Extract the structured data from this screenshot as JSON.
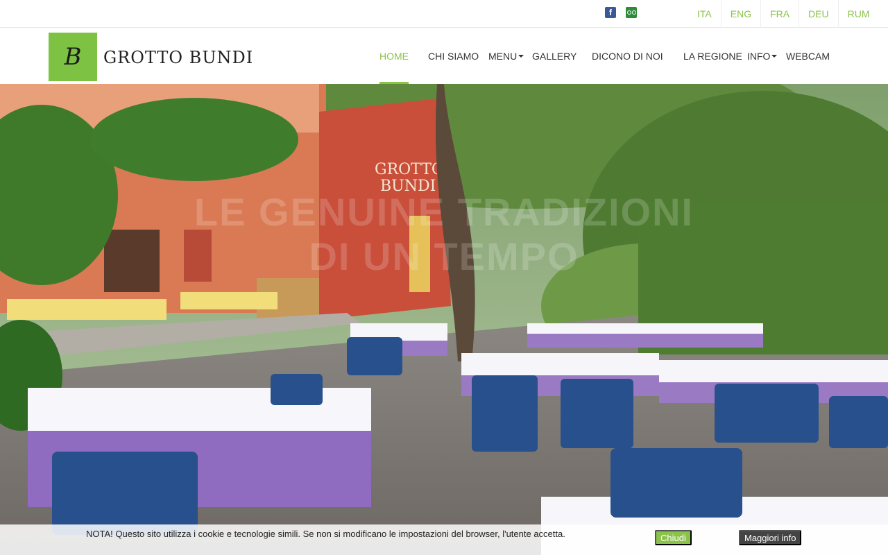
{
  "topbar": {
    "social": [
      {
        "name": "facebook-icon",
        "glyph": "f"
      },
      {
        "name": "tripadvisor-icon"
      }
    ],
    "languages": [
      "ITA",
      "ENG",
      "FRA",
      "DEU",
      "RUM"
    ]
  },
  "header": {
    "logo_mark": "B",
    "logo_text": "GROTTO BUNDI",
    "nav": [
      {
        "label": "HOME",
        "active": true
      },
      {
        "label": "CHI SIAMO"
      },
      {
        "label": "MENU",
        "dropdown": true
      },
      {
        "label": "GALLERY"
      },
      {
        "label": "DICONO DI NOI"
      },
      {
        "label": "LA REGIONE"
      },
      {
        "label": "INFO",
        "dropdown": true
      },
      {
        "label": "WEBCAM"
      }
    ]
  },
  "hero": {
    "sign": [
      "GROTTO",
      "BUNDI"
    ],
    "headline": [
      "LE GENUINE TRADIZIONI",
      "DI UN TEMPO"
    ]
  },
  "cookie": {
    "text": "NOTA! Questo sito utilizza i cookie e tecnologie simili. Se non si modificano le impostazioni del browser, l'utente accetta.",
    "accept_label": "Chiudi",
    "more_label": "Maggiori info"
  },
  "colors": {
    "accent": "#8bc34a",
    "logo_bg": "#7dc242",
    "facebook": "#3b5998",
    "tripadvisor": "#2e8b3a"
  }
}
